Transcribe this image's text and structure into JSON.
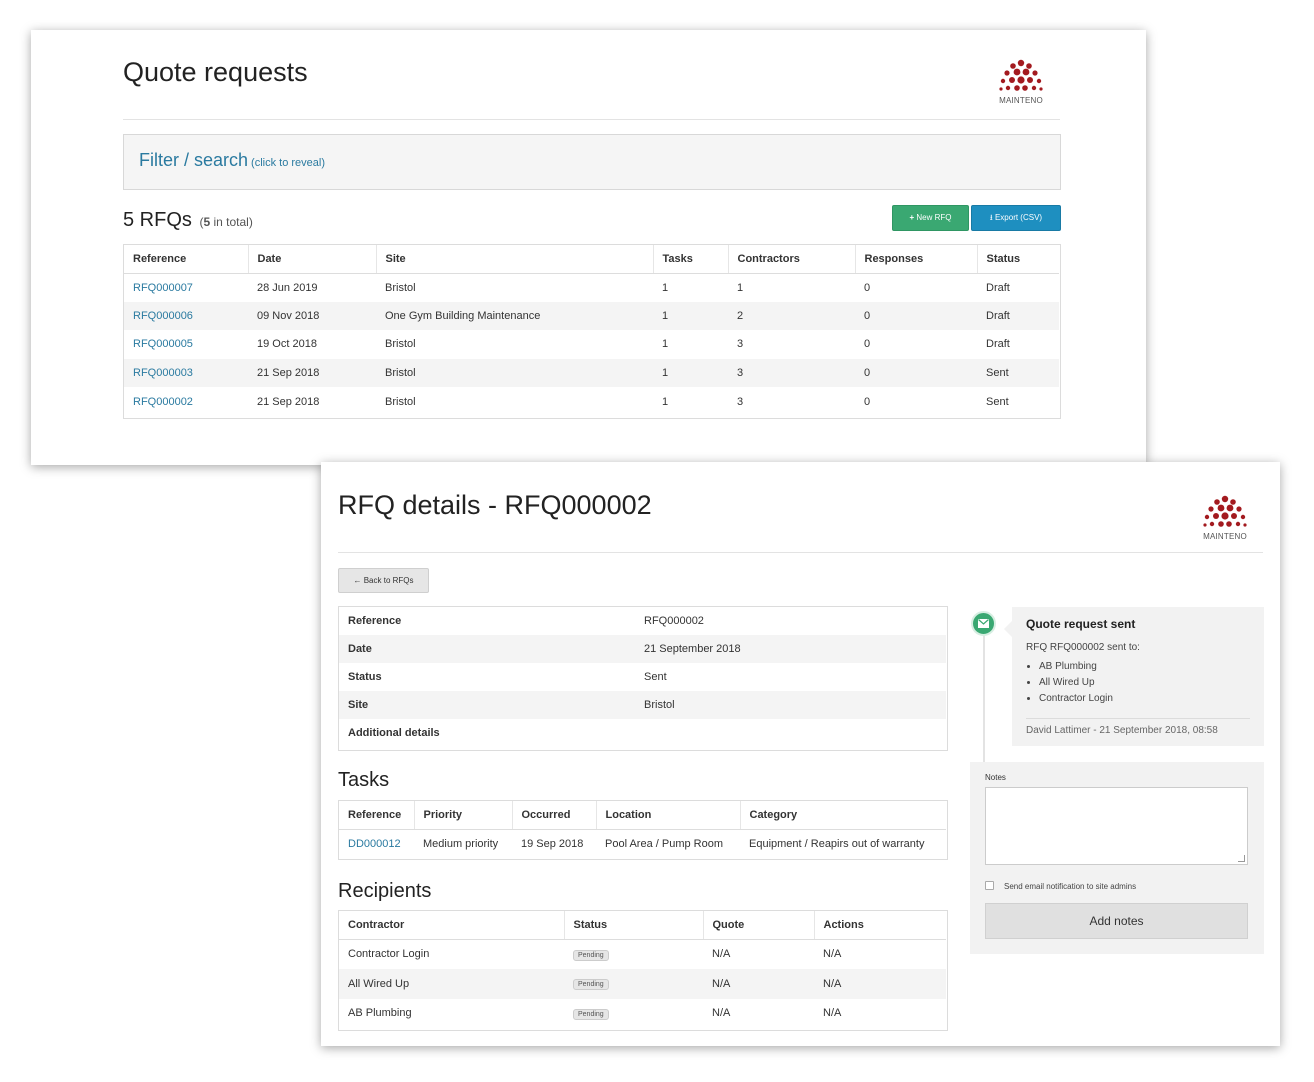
{
  "brand": {
    "logo_text": "MAINTENO",
    "accent": "#a31a1f"
  },
  "list_page": {
    "title": "Quote requests",
    "filter": {
      "title": "Filter / search",
      "hint": "(click to reveal)"
    },
    "count": {
      "label": "5 RFQs",
      "total_open": "(",
      "total_num": "5",
      "total_close": " in total)"
    },
    "buttons": {
      "new_rfq": "New RFQ",
      "export": "Export (CSV)"
    },
    "columns": [
      "Reference",
      "Date",
      "Site",
      "Tasks",
      "Contractors",
      "Responses",
      "Status"
    ],
    "rows": [
      [
        "RFQ000007",
        "28 Jun 2019",
        "Bristol",
        "1",
        "1",
        "0",
        "Draft"
      ],
      [
        "RFQ000006",
        "09 Nov 2018",
        "One Gym Building Maintenance",
        "1",
        "2",
        "0",
        "Draft"
      ],
      [
        "RFQ000005",
        "19 Oct 2018",
        "Bristol",
        "1",
        "3",
        "0",
        "Draft"
      ],
      [
        "RFQ000003",
        "21 Sep 2018",
        "Bristol",
        "1",
        "3",
        "0",
        "Sent"
      ],
      [
        "RFQ000002",
        "21 Sep 2018",
        "Bristol",
        "1",
        "3",
        "0",
        "Sent"
      ]
    ]
  },
  "detail_page": {
    "title": "RFQ details - RFQ000002",
    "back_button": "Back to RFQs",
    "details": [
      [
        "Reference",
        "RFQ000002"
      ],
      [
        "Date",
        "21 September 2018"
      ],
      [
        "Status",
        "Sent"
      ],
      [
        "Site",
        "Bristol"
      ],
      [
        "Additional details",
        ""
      ]
    ],
    "tasks": {
      "title": "Tasks",
      "columns": [
        "Reference",
        "Priority",
        "Occurred",
        "Location",
        "Category"
      ],
      "rows": [
        [
          "DD000012",
          "Medium priority",
          "19 Sep 2018",
          "Pool Area / Pump Room",
          "Equipment / Reapirs out of warranty"
        ]
      ]
    },
    "recipients": {
      "title": "Recipients",
      "columns": [
        "Contractor",
        "Status",
        "Quote",
        "Actions"
      ],
      "rows": [
        [
          "Contractor Login",
          "Pending",
          "N/A",
          "N/A"
        ],
        [
          "All Wired Up",
          "Pending",
          "N/A",
          "N/A"
        ],
        [
          "AB Plumbing",
          "Pending",
          "N/A",
          "N/A"
        ]
      ]
    },
    "timeline": {
      "heading": "Quote request sent",
      "sub": "RFQ RFQ000002 sent to:",
      "items": [
        "AB Plumbing",
        "All Wired Up",
        "Contractor Login"
      ],
      "footer": "David Lattimer - 21 September 2018, 08:58",
      "icon": "envelope-icon"
    },
    "notes": {
      "label": "Notes",
      "placeholder": "",
      "checkbox_label": "Send email notification to site admins",
      "checked": false,
      "submit": "Add notes"
    }
  }
}
